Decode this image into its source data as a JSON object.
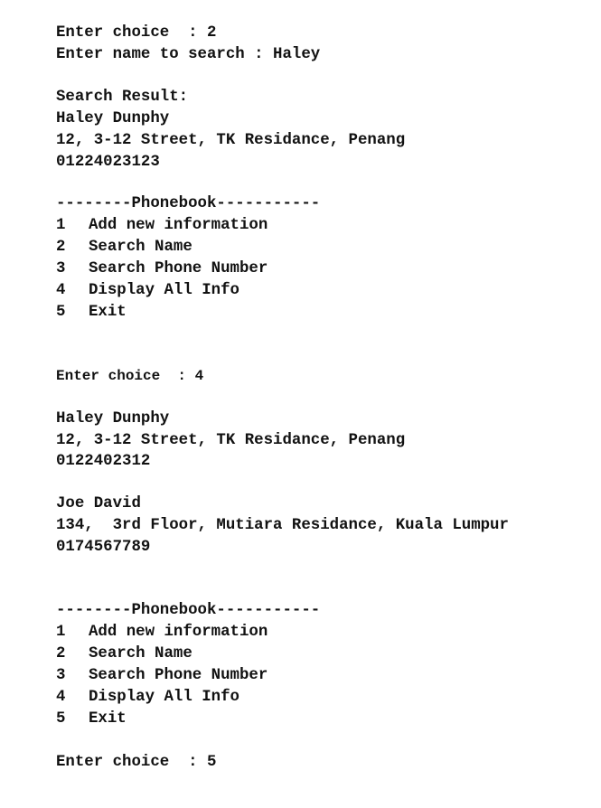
{
  "session": {
    "first_prompt": {
      "choice_label": "Enter choice  : 2",
      "search_label": "Enter name to search : Haley"
    },
    "search_result": {
      "heading": "Search Result:",
      "name": "Haley Dunphy",
      "address": "12, 3-12 Street, TK Residance, Penang",
      "phone": "01224023123"
    },
    "menu": {
      "title": "--------Phonebook-----------",
      "items": [
        {
          "num": "1",
          "label": "Add new information"
        },
        {
          "num": "2",
          "label": "Search Name"
        },
        {
          "num": "3",
          "label": "Search Phone Number"
        },
        {
          "num": "4",
          "label": "Display All Info"
        },
        {
          "num": "5",
          "label": "Exit"
        }
      ]
    },
    "second_prompt": {
      "choice_label": "Enter choice  : 4"
    },
    "all_records": [
      {
        "name": "Haley Dunphy",
        "address": "12, 3-12 Street, TK Residance, Penang",
        "phone": "0122402312"
      },
      {
        "name": "Joe David",
        "address": "134,  3rd Floor, Mutiara Residance, Kuala Lumpur",
        "phone": "0174567789"
      }
    ],
    "third_prompt": {
      "choice_label": "Enter choice  : 5"
    }
  }
}
